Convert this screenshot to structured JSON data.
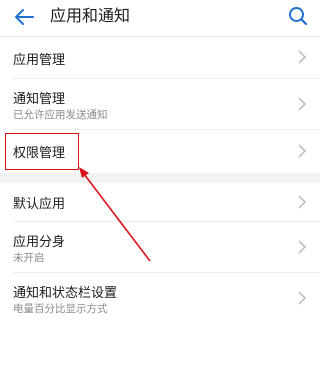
{
  "header": {
    "title": "应用和通知",
    "back_icon": "back-arrow-icon",
    "search_icon": "search-icon"
  },
  "items": [
    {
      "id": "app-management",
      "title": "应用管理",
      "subtitle": ""
    },
    {
      "id": "notification-management",
      "title": "通知管理",
      "subtitle": "已允许应用发送通知"
    },
    {
      "id": "permission-management",
      "title": "权限管理",
      "subtitle": ""
    },
    {
      "id": "default-apps",
      "title": "默认应用",
      "subtitle": ""
    },
    {
      "id": "app-twin",
      "title": "应用分身",
      "subtitle": "未开启"
    },
    {
      "id": "notification-status-bar",
      "title": "通知和状态栏设置",
      "subtitle": "电量百分比显示方式"
    }
  ],
  "colors": {
    "accent": "#1f6fd1",
    "annotation": "#d9141c",
    "text_primary": "#1a1a1a",
    "text_secondary": "#8a8a8a"
  }
}
